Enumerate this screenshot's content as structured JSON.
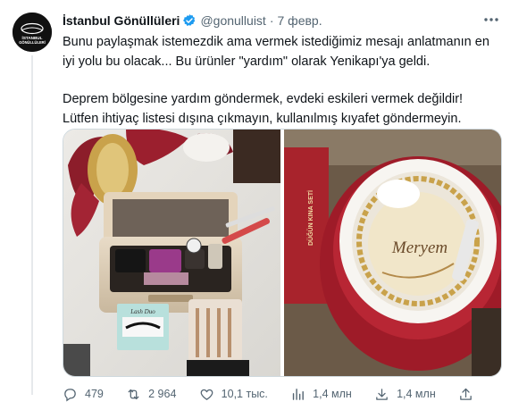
{
  "tweet": {
    "author_name": "İstanbul Gönüllüleri",
    "handle": "@gonulluist",
    "separator": "·",
    "date": "7 февр.",
    "text_p1": "Bunu paylaşmak istemezdik ama vermek istediğimiz mesajı anlatmanın en iyi yolu bu olacak... Bu ürünler \"yardım\" olarak Yenikapı'ya geldi.",
    "text_p2": "Deprem bölgesine yardım göndermek, evdeki eskileri vermek değildir! Lütfen ihtiyaç listesi dışına çıkmayın, kullanılmış kıyafet göndermeyin.",
    "avatar_text": "İSTANBUL GÖNÜLLÜLERİ"
  },
  "photos": {
    "left_lash_brand": "Lash Duo",
    "right_box_text": "DÜĞÜN KINA SETİ",
    "right_name": "Meryem"
  },
  "actions": {
    "replies": "479",
    "retweets": "2 964",
    "likes": "10,1 тыс.",
    "views": "1,4 млн",
    "downloads": "1,4 млн"
  },
  "colors": {
    "verified": "#1d9bf0",
    "text_secondary": "#536471"
  },
  "icons": [
    "verified-icon",
    "more-icon",
    "reply-icon",
    "retweet-icon",
    "like-icon",
    "views-icon",
    "download-icon",
    "share-icon"
  ]
}
